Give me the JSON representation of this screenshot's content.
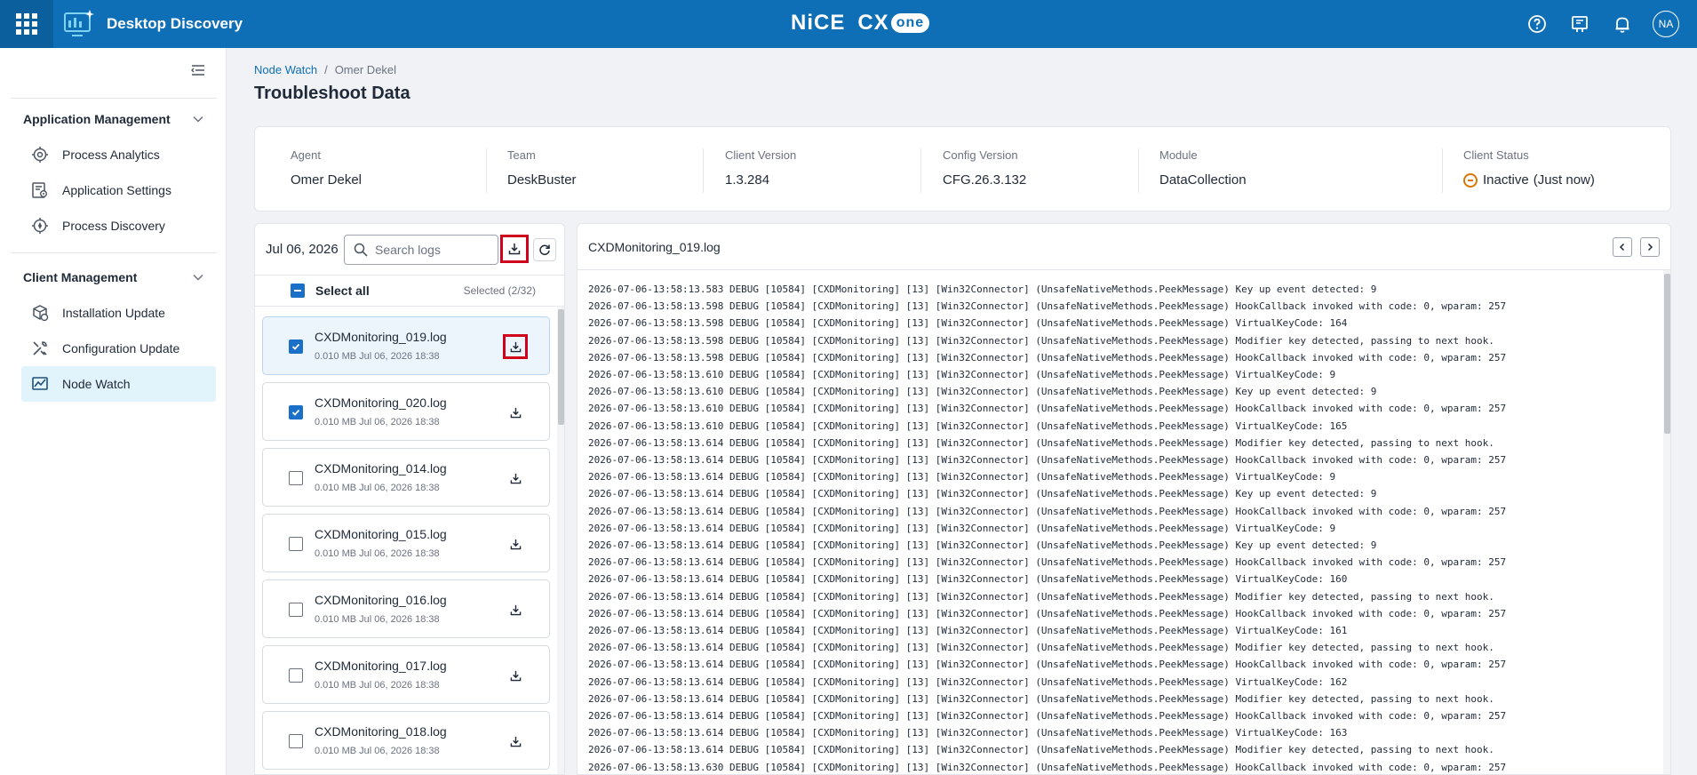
{
  "header": {
    "app_title": "Desktop Discovery",
    "brand_nice": "NiCE",
    "brand_cx": "CX",
    "brand_one": "one",
    "avatar_initials": "NA",
    "icons": [
      "apps-grid-icon",
      "help-icon",
      "announcements-icon",
      "notifications-icon"
    ]
  },
  "sidebar": {
    "sections": [
      {
        "title": "Application Management",
        "items": [
          {
            "label": "Process Analytics",
            "icon": "process-analytics-icon"
          },
          {
            "label": "Application Settings",
            "icon": "application-settings-icon"
          },
          {
            "label": "Process Discovery",
            "icon": "process-discovery-icon"
          }
        ]
      },
      {
        "title": "Client Management",
        "items": [
          {
            "label": "Installation Update",
            "icon": "installation-update-icon"
          },
          {
            "label": "Configuration Update",
            "icon": "configuration-update-icon"
          },
          {
            "label": "Node Watch",
            "icon": "node-watch-icon",
            "active": true
          }
        ]
      }
    ]
  },
  "breadcrumb": {
    "parent": "Node Watch",
    "separator": "/",
    "current": "Omer Dekel"
  },
  "page_title": "Troubleshoot Data",
  "info": {
    "agent": {
      "label": "Agent",
      "value": "Omer Dekel"
    },
    "team": {
      "label": "Team",
      "value": "DeskBuster"
    },
    "client_version": {
      "label": "Client Version",
      "value": "1.3.284"
    },
    "config_version": {
      "label": "Config Version",
      "value": "CFG.26.3.132"
    },
    "module": {
      "label": "Module",
      "value": "DataCollection"
    },
    "client_status": {
      "label": "Client Status",
      "value": "Inactive",
      "detail": "(Just now)",
      "color": "#d97706"
    }
  },
  "logs_panel": {
    "date": "Jul 06, 2026",
    "search_placeholder": "Search logs",
    "select_all_label": "Select all",
    "selected_count": "Selected (2/32)",
    "files": [
      {
        "name": "CXDMonitoring_019.log",
        "meta": "0.010 MB Jul 06, 2026 18:38",
        "checked": true,
        "active": true
      },
      {
        "name": "CXDMonitoring_020.log",
        "meta": "0.010 MB Jul 06, 2026 18:38",
        "checked": true,
        "active": false
      },
      {
        "name": "CXDMonitoring_014.log",
        "meta": "0.010 MB Jul 06, 2026 18:38",
        "checked": false,
        "active": false
      },
      {
        "name": "CXDMonitoring_015.log",
        "meta": "0.010 MB Jul 06, 2026 18:38",
        "checked": false,
        "active": false
      },
      {
        "name": "CXDMonitoring_016.log",
        "meta": "0.010 MB Jul 06, 2026 18:38",
        "checked": false,
        "active": false
      },
      {
        "name": "CXDMonitoring_017.log",
        "meta": "0.010 MB Jul 06, 2026 18:38",
        "checked": false,
        "active": false
      },
      {
        "name": "CXDMonitoring_018.log",
        "meta": "0.010 MB Jul 06, 2026 18:38",
        "checked": false,
        "active": false
      }
    ]
  },
  "viewer": {
    "title": "CXDMonitoring_019.log",
    "lines": [
      "2026-07-06-13:58:13.583 DEBUG [10584] [CXDMonitoring] [13] [Win32Connector] (UnsafeNativeMethods.PeekMessage) Key up event detected: 9",
      "2026-07-06-13:58:13.598 DEBUG [10584] [CXDMonitoring] [13] [Win32Connector] (UnsafeNativeMethods.PeekMessage) HookCallback invoked with code: 0, wparam: 257",
      "2026-07-06-13:58:13.598 DEBUG [10584] [CXDMonitoring] [13] [Win32Connector] (UnsafeNativeMethods.PeekMessage) VirtualKeyCode: 164",
      "2026-07-06-13:58:13.598 DEBUG [10584] [CXDMonitoring] [13] [Win32Connector] (UnsafeNativeMethods.PeekMessage) Modifier key detected, passing to next hook.",
      "2026-07-06-13:58:13.598 DEBUG [10584] [CXDMonitoring] [13] [Win32Connector] (UnsafeNativeMethods.PeekMessage) HookCallback invoked with code: 0, wparam: 257",
      "2026-07-06-13:58:13.610 DEBUG [10584] [CXDMonitoring] [13] [Win32Connector] (UnsafeNativeMethods.PeekMessage) VirtualKeyCode: 9",
      "2026-07-06-13:58:13.610 DEBUG [10584] [CXDMonitoring] [13] [Win32Connector] (UnsafeNativeMethods.PeekMessage) Key up event detected: 9",
      "2026-07-06-13:58:13.610 DEBUG [10584] [CXDMonitoring] [13] [Win32Connector] (UnsafeNativeMethods.PeekMessage) HookCallback invoked with code: 0, wparam: 257",
      "2026-07-06-13:58:13.610 DEBUG [10584] [CXDMonitoring] [13] [Win32Connector] (UnsafeNativeMethods.PeekMessage) VirtualKeyCode: 165",
      "2026-07-06-13:58:13.614 DEBUG [10584] [CXDMonitoring] [13] [Win32Connector] (UnsafeNativeMethods.PeekMessage) Modifier key detected, passing to next hook.",
      "2026-07-06-13:58:13.614 DEBUG [10584] [CXDMonitoring] [13] [Win32Connector] (UnsafeNativeMethods.PeekMessage) HookCallback invoked with code: 0, wparam: 257",
      "2026-07-06-13:58:13.614 DEBUG [10584] [CXDMonitoring] [13] [Win32Connector] (UnsafeNativeMethods.PeekMessage) VirtualKeyCode: 9",
      "2026-07-06-13:58:13.614 DEBUG [10584] [CXDMonitoring] [13] [Win32Connector] (UnsafeNativeMethods.PeekMessage) Key up event detected: 9",
      "2026-07-06-13:58:13.614 DEBUG [10584] [CXDMonitoring] [13] [Win32Connector] (UnsafeNativeMethods.PeekMessage) HookCallback invoked with code: 0, wparam: 257",
      "2026-07-06-13:58:13.614 DEBUG [10584] [CXDMonitoring] [13] [Win32Connector] (UnsafeNativeMethods.PeekMessage) VirtualKeyCode: 9",
      "2026-07-06-13:58:13.614 DEBUG [10584] [CXDMonitoring] [13] [Win32Connector] (UnsafeNativeMethods.PeekMessage) Key up event detected: 9",
      "2026-07-06-13:58:13.614 DEBUG [10584] [CXDMonitoring] [13] [Win32Connector] (UnsafeNativeMethods.PeekMessage) HookCallback invoked with code: 0, wparam: 257",
      "2026-07-06-13:58:13.614 DEBUG [10584] [CXDMonitoring] [13] [Win32Connector] (UnsafeNativeMethods.PeekMessage) VirtualKeyCode: 160",
      "2026-07-06-13:58:13.614 DEBUG [10584] [CXDMonitoring] [13] [Win32Connector] (UnsafeNativeMethods.PeekMessage) Modifier key detected, passing to next hook.",
      "2026-07-06-13:58:13.614 DEBUG [10584] [CXDMonitoring] [13] [Win32Connector] (UnsafeNativeMethods.PeekMessage) HookCallback invoked with code: 0, wparam: 257",
      "2026-07-06-13:58:13.614 DEBUG [10584] [CXDMonitoring] [13] [Win32Connector] (UnsafeNativeMethods.PeekMessage) VirtualKeyCode: 161",
      "2026-07-06-13:58:13.614 DEBUG [10584] [CXDMonitoring] [13] [Win32Connector] (UnsafeNativeMethods.PeekMessage) Modifier key detected, passing to next hook.",
      "2026-07-06-13:58:13.614 DEBUG [10584] [CXDMonitoring] [13] [Win32Connector] (UnsafeNativeMethods.PeekMessage) HookCallback invoked with code: 0, wparam: 257",
      "2026-07-06-13:58:13.614 DEBUG [10584] [CXDMonitoring] [13] [Win32Connector] (UnsafeNativeMethods.PeekMessage) VirtualKeyCode: 162",
      "2026-07-06-13:58:13.614 DEBUG [10584] [CXDMonitoring] [13] [Win32Connector] (UnsafeNativeMethods.PeekMessage) Modifier key detected, passing to next hook.",
      "2026-07-06-13:58:13.614 DEBUG [10584] [CXDMonitoring] [13] [Win32Connector] (UnsafeNativeMethods.PeekMessage) HookCallback invoked with code: 0, wparam: 257",
      "2026-07-06-13:58:13.614 DEBUG [10584] [CXDMonitoring] [13] [Win32Connector] (UnsafeNativeMethods.PeekMessage) VirtualKeyCode: 163",
      "2026-07-06-13:58:13.614 DEBUG [10584] [CXDMonitoring] [13] [Win32Connector] (UnsafeNativeMethods.PeekMessage) Modifier key detected, passing to next hook.",
      "2026-07-06-13:58:13.630 DEBUG [10584] [CXDMonitoring] [13] [Win32Connector] (UnsafeNativeMethods.PeekMessage) HookCallback invoked with code: 0, wparam: 257"
    ]
  },
  "colors": {
    "header_blue": "#0f6fb6",
    "active_nav_bg": "#e1f4fb",
    "highlight_red": "#d0021b",
    "checkbox_blue": "#1a6fc9"
  }
}
